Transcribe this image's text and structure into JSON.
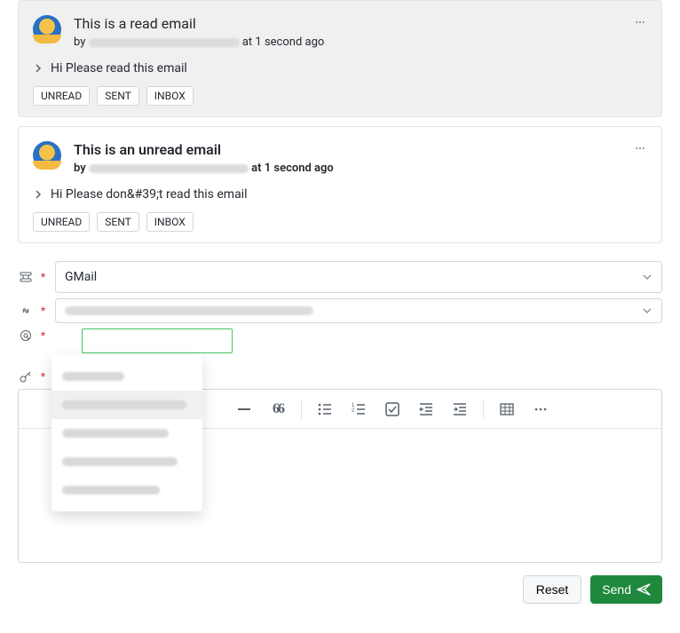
{
  "emails": [
    {
      "title": "This is a read email",
      "by_prefix": "by",
      "timestamp": "at 1 second ago",
      "snippet": "Hi Please read this email",
      "tags": [
        "UNREAD",
        "SENT",
        "INBOX"
      ]
    },
    {
      "title": "This is an unread email",
      "by_prefix": "by",
      "timestamp": "at 1 second ago",
      "snippet": "Hi Please don&#39;t read this email",
      "tags": [
        "UNREAD",
        "SENT",
        "INBOX"
      ]
    }
  ],
  "form": {
    "provider": "GMail",
    "required": "*"
  },
  "footer": {
    "reset": "Reset",
    "send": "Send"
  },
  "toolbar": {
    "quote": "66"
  }
}
